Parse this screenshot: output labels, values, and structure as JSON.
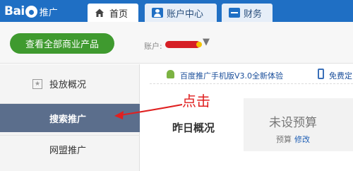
{
  "header": {
    "logo_text": "Bai",
    "logo_suffix": "推广",
    "tabs": [
      {
        "label": "首页",
        "icon": "home-icon",
        "active": true
      },
      {
        "label": "账户中心",
        "icon": "user-icon",
        "active": false
      },
      {
        "label": "财务",
        "icon": "wallet-icon",
        "active": false
      }
    ]
  },
  "subheader": {
    "view_all_button": "查看全部商业产品",
    "account_label": "账户:",
    "account_name_redacted": true
  },
  "sidebar": {
    "items": [
      {
        "label": "投放概况",
        "icon": "overview-icon",
        "active": false
      },
      {
        "label": "搜索推广",
        "active": true
      },
      {
        "label": "网盟推广",
        "active": false
      }
    ]
  },
  "notices": [
    {
      "text": "百度推广手机版V3.0全新体验",
      "icon": "android-icon"
    },
    {
      "text": "免费定",
      "icon": "phone-icon"
    }
  ],
  "main": {
    "section_title": "昨日概况",
    "budget": {
      "status": "未设预算",
      "label": "预算",
      "edit_link": "修改"
    }
  },
  "annotation": {
    "text": "点击",
    "color": "#e02020"
  },
  "colors": {
    "topbar": "#1f6fc4",
    "view_all_button": "#3f9a2f",
    "sidebar_active": "#5b6e8c"
  }
}
